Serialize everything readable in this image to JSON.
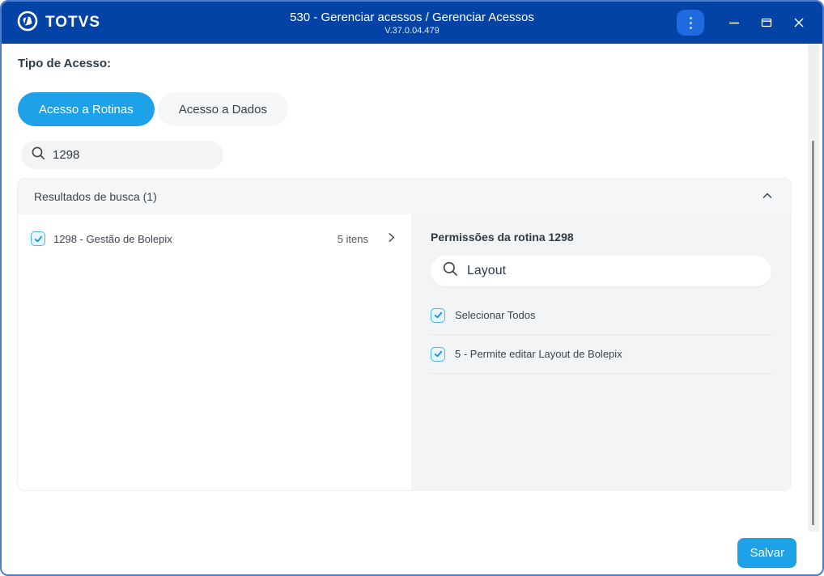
{
  "titlebar": {
    "brand": "TOTVS",
    "title": "530 - Gerenciar acessos / Gerenciar Acessos",
    "version": "V.37.0.04.479"
  },
  "access_type": {
    "label": "Tipo de Acesso:",
    "tabs": [
      {
        "label": "Acesso a Rotinas",
        "active": true
      },
      {
        "label": "Acesso a Dados",
        "active": false
      }
    ]
  },
  "routine_search": {
    "value": "1298"
  },
  "results": {
    "header": "Resultados de busca (1)",
    "items": [
      {
        "checked": true,
        "label": "1298 - Gestão de Bolepix",
        "count": "5 itens"
      }
    ]
  },
  "permissions": {
    "title": "Permissões da rotina 1298",
    "search_value": "Layout",
    "options": [
      {
        "checked": true,
        "label": "Selecionar Todos"
      },
      {
        "checked": true,
        "label": "5 - Permite editar Layout de Bolepix"
      }
    ]
  },
  "footer": {
    "save_label": "Salvar"
  },
  "colors": {
    "titlebar": "#0343a6",
    "accent": "#1da1e8",
    "panel_gray": "#f2f4f6",
    "checkbox_border": "#41b9f0",
    "checkbox_fill": "#e7f6fe",
    "check_mark": "#0d96de"
  }
}
